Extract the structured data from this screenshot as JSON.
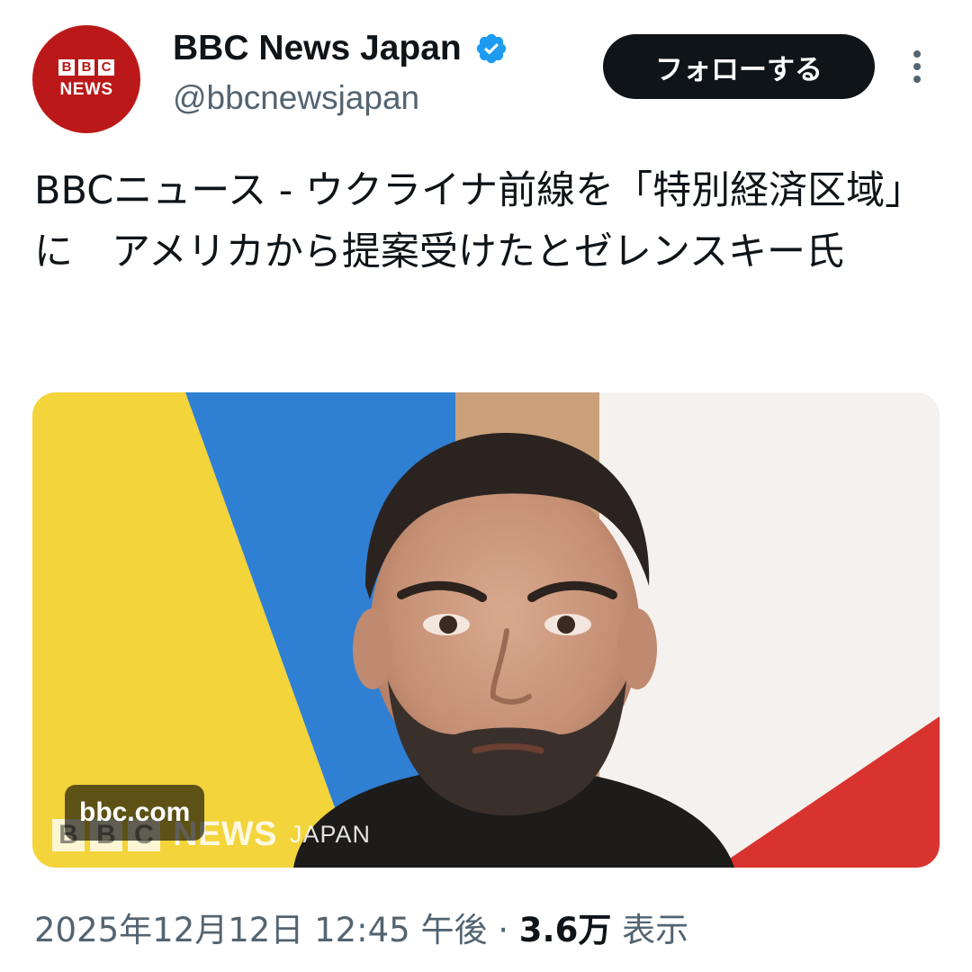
{
  "author": {
    "avatar": {
      "blocks": [
        "B",
        "B",
        "C"
      ],
      "wordmark": "NEWS"
    },
    "display_name": "BBC News Japan",
    "handle": "@bbcnewsjapan",
    "verified_icon": "verified-badge-icon",
    "verified_color": "#1d9bf0"
  },
  "follow_button": {
    "label": "フォローする"
  },
  "more_icon": "more-vertical-icon",
  "tweet": {
    "text": "BBCニュース - ウクライナ前線を「特別経済区域」に　アメリカから提案受けたとゼレンスキー氏"
  },
  "media": {
    "domain_badge": "bbc.com",
    "watermark": {
      "blocks": [
        "B",
        "B",
        "C"
      ],
      "news": "NEWS",
      "region": "JAPAN"
    }
  },
  "meta": {
    "date": "2025年12月12日",
    "time": "12:45 午後",
    "separator": "·",
    "views_count": "3.6万",
    "views_label": "表示"
  },
  "colors": {
    "brand_red": "#bb1919",
    "text_primary": "#0f1419",
    "text_secondary": "#536471",
    "button_bg": "#0f1419",
    "verified_blue": "#1d9bf0"
  }
}
